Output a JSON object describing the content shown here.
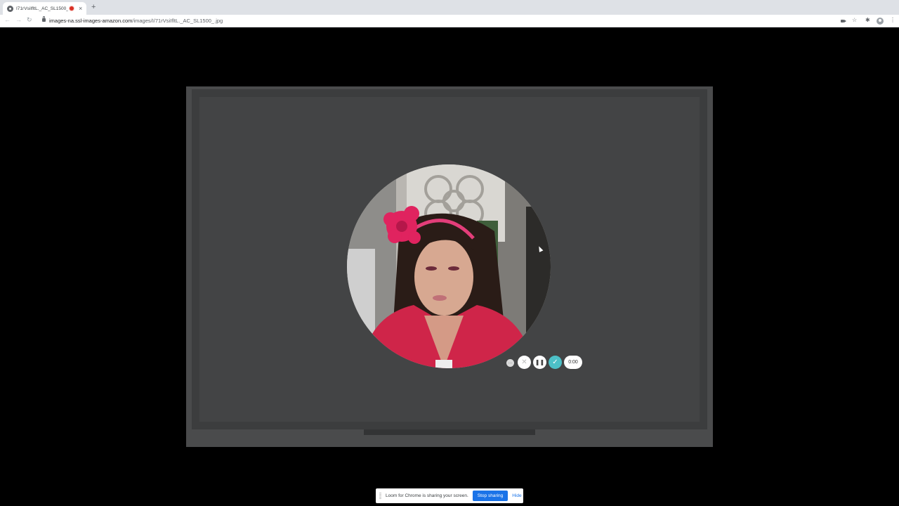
{
  "browser": {
    "tab": {
      "title": "I71rVsiIfltL._AC_SL1500_.jpg",
      "close_glyph": "×",
      "favicon": "globe-icon",
      "recording_indicator_color": "#d93025"
    },
    "new_tab_glyph": "+",
    "nav": {
      "back_glyph": "←",
      "forward_glyph": "→",
      "reload_glyph": "↻"
    },
    "address": {
      "domain": "images-na.ssl-images-amazon.com",
      "path": "/images/I/71rVsiIfltL._AC_SL1500_.jpg"
    },
    "toolbar_icons": {
      "star_glyph": "☆",
      "extensions_glyph": "✱",
      "menu_glyph": "⋮"
    }
  },
  "loom_controls": {
    "more_glyph": "···",
    "cancel_glyph": "✕",
    "pause_glyph": "❚❚",
    "done_glyph": "✓",
    "timer": "0:00",
    "accent_color": "#4dc0c7"
  },
  "sharing_bar": {
    "message": "Loom for Chrome is sharing your screen.",
    "stop_label": "Stop sharing",
    "hide_label": "Hide"
  }
}
